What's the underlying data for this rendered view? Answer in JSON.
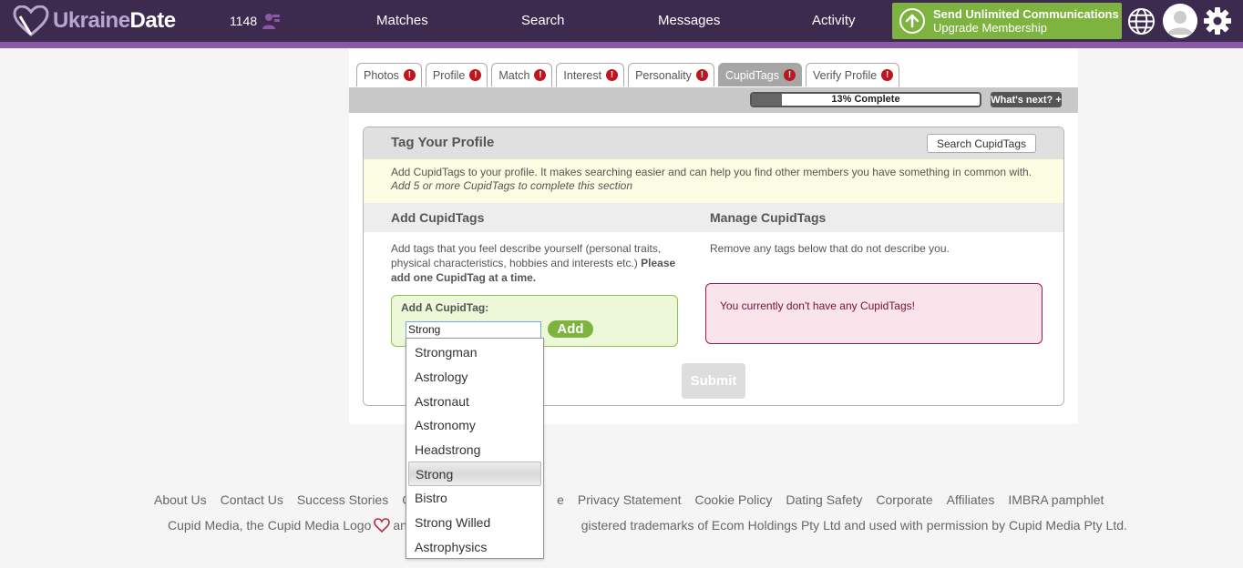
{
  "header": {
    "logo_light": "Ukraine",
    "logo_bold": "Date",
    "count": "1148",
    "nav": [
      "Matches",
      "Search",
      "Messages",
      "Activity"
    ],
    "upgrade_line1": "Send Unlimited Communications",
    "upgrade_line2": "Upgrade Membership",
    "colors": {
      "bar": "#3d2b4f",
      "stripe": "#8a5aa8",
      "upgrade": "#7db33e"
    }
  },
  "tabs": [
    {
      "label": "Photos",
      "active": false
    },
    {
      "label": "Profile",
      "active": false
    },
    {
      "label": "Match",
      "active": false
    },
    {
      "label": "Interest",
      "active": false
    },
    {
      "label": "Personality",
      "active": false
    },
    {
      "label": "CupidTags",
      "active": true
    },
    {
      "label": "Verify Profile",
      "active": false
    }
  ],
  "progress": {
    "text": "13% Complete",
    "value": 0.13,
    "whats_next": "What's next? +"
  },
  "section": {
    "title": "Tag Your Profile",
    "search_button": "Search CupidTags",
    "info_line1": "Add CupidTags to your profile. It makes searching easier and can help you find other members you have something in common with.",
    "info_line2": "Add 5 or more CupidTags to complete this section",
    "add_title": "Add CupidTags",
    "manage_title": "Manage CupidTags",
    "add_desc_line1": "Add tags that you feel describe yourself (personal traits,",
    "add_desc_line2_plain": "physical characteristics, hobbies and interests etc.)",
    "add_desc_line2_bold": "Please",
    "add_desc_line3_bold": "add one CupidTag at a time.",
    "manage_desc": "Remove any tags below that do not describe you.",
    "add_label": "Add A CupidTag:",
    "input_value": "Strong",
    "add_button": "Add",
    "empty_message": "You currently don't have any CupidTags!",
    "submit": "Submit"
  },
  "autocomplete": {
    "items": [
      "Strongman",
      "Astrology",
      "Astronaut",
      "Astronomy",
      "Headstrong",
      "Strong",
      "Bistro",
      "Strong Willed",
      "Astrophysics"
    ],
    "highlighted": "Strong"
  },
  "footer": {
    "links": [
      "About Us",
      "Contact Us",
      "Success Stories",
      "O",
      "e",
      "Privacy Statement",
      "Cookie Policy",
      "Dating Safety",
      "Corporate",
      "Affiliates",
      "IMBRA pamphlet"
    ],
    "legal_a": "Cupid Media, the Cupid Media Logo",
    "legal_b": "and",
    "legal_c": "gistered trademarks of Ecom Holdings Pty Ltd and used with permission by Cupid Media Pty Ltd."
  }
}
